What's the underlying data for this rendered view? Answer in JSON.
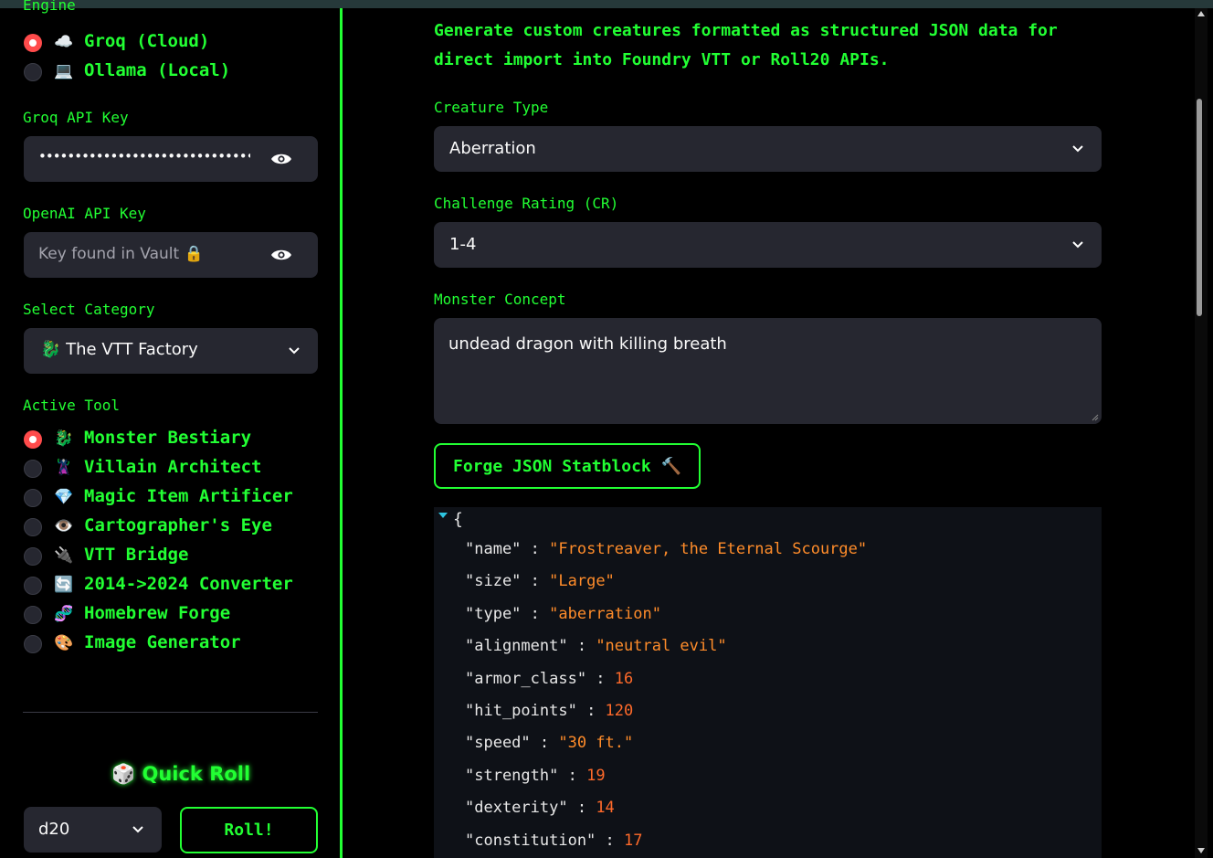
{
  "sidebar": {
    "engine_label": "Engine",
    "engines": [
      {
        "icon": "☁️",
        "label": "Groq (Cloud)",
        "selected": true
      },
      {
        "icon": "💻",
        "label": "Ollama (Local)",
        "selected": false
      }
    ],
    "groq_key_label": "Groq API Key",
    "groq_key_value": "••••••••••••••••••••••••••••••••••••••••",
    "openai_key_label": "OpenAI API Key",
    "openai_key_placeholder": "Key found in Vault 🔒",
    "category_label": "Select Category",
    "category_icon": "🐉",
    "category_value": "The VTT Factory",
    "tool_label": "Active Tool",
    "tools": [
      {
        "icon": "🐉",
        "label": "Monster Bestiary",
        "selected": true
      },
      {
        "icon": "🦹",
        "label": "Villain Architect",
        "selected": false
      },
      {
        "icon": "💎",
        "label": "Magic Item Artificer",
        "selected": false
      },
      {
        "icon": "👁️",
        "label": "Cartographer's Eye",
        "selected": false
      },
      {
        "icon": "🔌",
        "label": "VTT Bridge",
        "selected": false
      },
      {
        "icon": "🔄",
        "label": "2014->2024 Converter",
        "selected": false
      },
      {
        "icon": "🧬",
        "label": "Homebrew Forge",
        "selected": false
      },
      {
        "icon": "🎨",
        "label": "Image Generator",
        "selected": false
      }
    ],
    "quick_roll_icon": "🎲",
    "quick_roll_label": "Quick Roll",
    "dice_value": "d20",
    "roll_button": "Roll!"
  },
  "main": {
    "description_line1": "Generate custom creatures formatted as structured JSON data for",
    "description_line2": "direct import into Foundry VTT or Roll20 APIs.",
    "creature_type_label": "Creature Type",
    "creature_type_value": "Aberration",
    "cr_label": "Challenge Rating (CR)",
    "cr_value": "1-4",
    "concept_label": "Monster Concept",
    "concept_value": "undead dragon with killing breath",
    "forge_button": "Forge JSON Statblock 🔨",
    "json_open_brace": "{",
    "json_fields": [
      {
        "key": "\"name\"",
        "value": "\"Frostreaver, the Eternal Scourge\"",
        "kind": "string"
      },
      {
        "key": "\"size\"",
        "value": "\"Large\"",
        "kind": "string"
      },
      {
        "key": "\"type\"",
        "value": "\"aberration\"",
        "kind": "string"
      },
      {
        "key": "\"alignment\"",
        "value": "\"neutral evil\"",
        "kind": "string"
      },
      {
        "key": "\"armor_class\"",
        "value": "16",
        "kind": "number"
      },
      {
        "key": "\"hit_points\"",
        "value": "120",
        "kind": "number"
      },
      {
        "key": "\"speed\"",
        "value": "\"30 ft.\"",
        "kind": "string"
      },
      {
        "key": "\"strength\"",
        "value": "19",
        "kind": "number"
      },
      {
        "key": "\"dexterity\"",
        "value": "14",
        "kind": "number"
      },
      {
        "key": "\"constitution\"",
        "value": "17",
        "kind": "number"
      }
    ]
  },
  "colors": {
    "accent": "#22ff33",
    "field_bg": "#262730",
    "radio_selected": "#ff4b4b",
    "json_string": "#ff8c2a",
    "json_number": "#ff6a2a"
  }
}
